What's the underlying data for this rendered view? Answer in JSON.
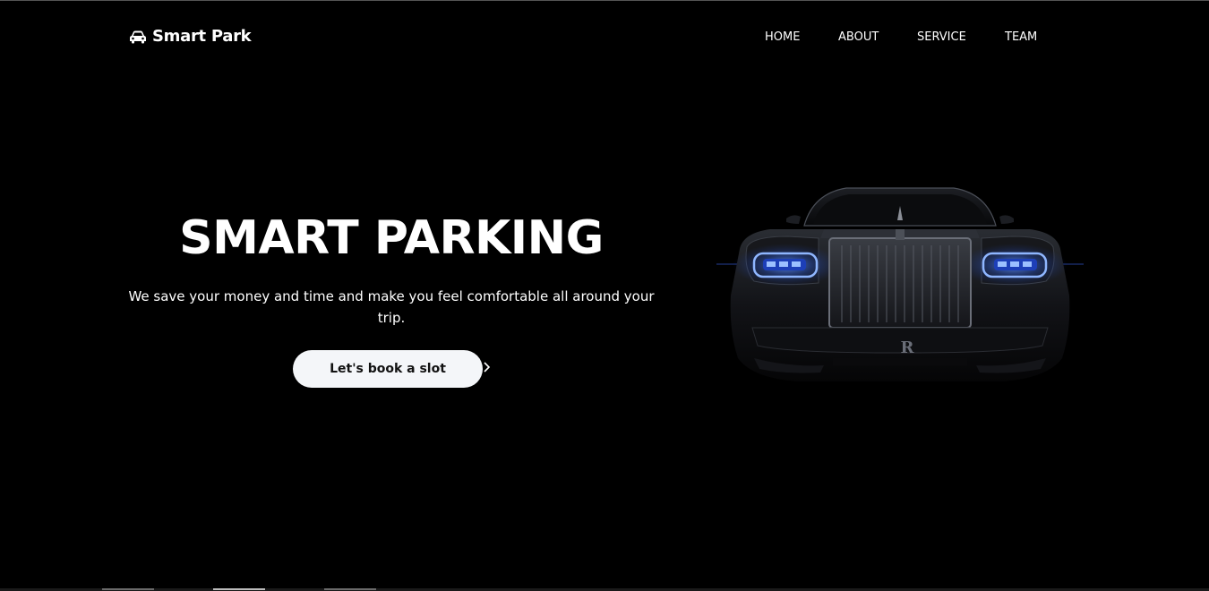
{
  "nav": {
    "brand": "Smart Park",
    "brand_icon": "car-icon",
    "links": [
      {
        "label": "HOME"
      },
      {
        "label": "ABOUT"
      },
      {
        "label": "SERVICE"
      },
      {
        "label": "TEAM"
      }
    ]
  },
  "hero": {
    "title": "SMART PARKING",
    "subtitle": "We save your money and time and make you feel comfortable all around your trip.",
    "cta_label": "Let's book a slot",
    "cta_icon": "chevron-right-icon",
    "image": "luxury-car-front-image"
  },
  "colors": {
    "background": "#000000",
    "text": "#ffffff",
    "button_bg": "#f4f6f9",
    "button_text": "#111111",
    "headlight": "#4a7dff"
  }
}
